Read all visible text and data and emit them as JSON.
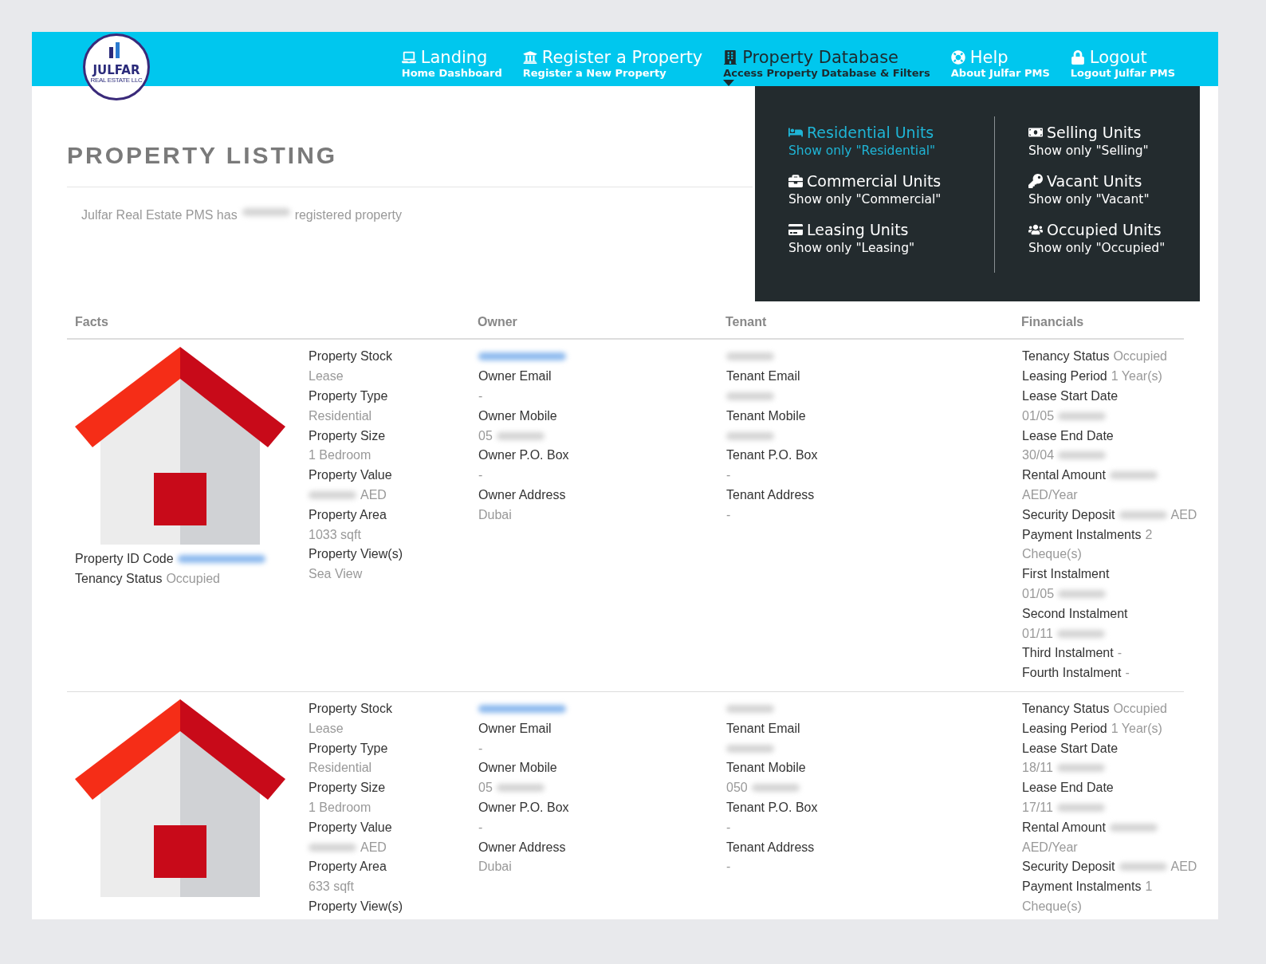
{
  "logo": {
    "name": "JULFAR",
    "tagline": "REAL ESTATE LLC"
  },
  "nav": [
    {
      "title": "Landing",
      "subtitle": "Home Dashboard",
      "selected": false
    },
    {
      "title": "Register a Property",
      "subtitle": "Register a New Property",
      "selected": false
    },
    {
      "title": "Property Database",
      "subtitle": "Access Property Database & Filters",
      "selected": true
    },
    {
      "title": "Help",
      "subtitle": "About Julfar PMS",
      "selected": false
    },
    {
      "title": "Logout",
      "subtitle": "Logout Julfar PMS",
      "selected": false
    }
  ],
  "dropdown": {
    "columns": [
      [
        {
          "title": "Residential Units",
          "subtitle": "Show only \"Residential\"",
          "selected": true
        },
        {
          "title": "Commercial Units",
          "subtitle": "Show only \"Commercial\"",
          "selected": false
        },
        {
          "title": "Leasing Units",
          "subtitle": "Show only \"Leasing\"",
          "selected": false
        }
      ],
      [
        {
          "title": "Selling Units",
          "subtitle": "Show only \"Selling\"",
          "selected": false
        },
        {
          "title": "Vacant Units",
          "subtitle": "Show only \"Vacant\"",
          "selected": false
        },
        {
          "title": "Occupied Units",
          "subtitle": "Show only \"Occupied\"",
          "selected": false
        }
      ]
    ]
  },
  "heading": "PROPERTY LISTING",
  "summary": [
    {
      "kind": "value",
      "text": "Julfar Real Estate PMS has"
    },
    {
      "kind": "blurred"
    },
    {
      "kind": "value",
      "text": "registered property"
    }
  ],
  "table": {
    "columns": [
      "Facts",
      "Owner",
      "Tenant",
      "Financials"
    ],
    "rows": [
      {
        "side": [
          [
            {
              "kind": "label",
              "text": "Property ID Code"
            },
            {
              "kind": "blurred_link"
            }
          ],
          [
            {
              "kind": "label",
              "text": "Tenancy Status"
            },
            {
              "kind": "value",
              "text": "Occupied"
            }
          ]
        ],
        "facts": [
          [
            {
              "kind": "label",
              "text": "Property Stock"
            }
          ],
          [
            {
              "kind": "value",
              "text": "Lease"
            }
          ],
          [
            {
              "kind": "label",
              "text": "Property Type"
            }
          ],
          [
            {
              "kind": "value",
              "text": "Residential"
            }
          ],
          [
            {
              "kind": "label",
              "text": "Property Size"
            }
          ],
          [
            {
              "kind": "value",
              "text": "1 Bedroom"
            }
          ],
          [
            {
              "kind": "label",
              "text": "Property Value"
            }
          ],
          [
            {
              "kind": "blurred"
            },
            {
              "kind": "value",
              "text": "AED"
            }
          ],
          [
            {
              "kind": "label",
              "text": "Property Area"
            }
          ],
          [
            {
              "kind": "value",
              "text": "1033 sqft"
            }
          ],
          [
            {
              "kind": "label",
              "text": "Property View(s)"
            }
          ],
          [
            {
              "kind": "value",
              "text": "Sea View"
            }
          ]
        ],
        "owner": [
          [
            {
              "kind": "blurred_link"
            }
          ],
          [
            {
              "kind": "label",
              "text": "Owner Email"
            }
          ],
          [
            {
              "kind": "value",
              "text": "-"
            }
          ],
          [
            {
              "kind": "label",
              "text": "Owner Mobile"
            }
          ],
          [
            {
              "kind": "value",
              "text": "05"
            },
            {
              "kind": "blurred"
            }
          ],
          [
            {
              "kind": "label",
              "text": "Owner P.O. Box"
            }
          ],
          [
            {
              "kind": "value",
              "text": "-"
            }
          ],
          [
            {
              "kind": "label",
              "text": "Owner Address"
            }
          ],
          [
            {
              "kind": "value",
              "text": "Dubai"
            }
          ]
        ],
        "tenant": [
          [
            {
              "kind": "blurred"
            }
          ],
          [
            {
              "kind": "label",
              "text": "Tenant Email"
            }
          ],
          [
            {
              "kind": "blurred"
            }
          ],
          [
            {
              "kind": "label",
              "text": "Tenant Mobile"
            }
          ],
          [
            {
              "kind": "blurred"
            }
          ],
          [
            {
              "kind": "label",
              "text": "Tenant P.O. Box"
            }
          ],
          [
            {
              "kind": "value",
              "text": "-"
            }
          ],
          [
            {
              "kind": "label",
              "text": "Tenant Address"
            }
          ],
          [
            {
              "kind": "value",
              "text": "-"
            }
          ]
        ],
        "financials": [
          [
            {
              "kind": "label",
              "text": "Tenancy Status"
            },
            {
              "kind": "value",
              "text": "Occupied"
            }
          ],
          [
            {
              "kind": "label",
              "text": "Leasing Period"
            },
            {
              "kind": "value",
              "text": "1 Year(s)"
            }
          ],
          [
            {
              "kind": "label",
              "text": "Lease Start Date"
            }
          ],
          [
            {
              "kind": "value",
              "text": "01/05"
            },
            {
              "kind": "blurred"
            }
          ],
          [
            {
              "kind": "label",
              "text": "Lease End Date"
            }
          ],
          [
            {
              "kind": "value",
              "text": "30/04"
            },
            {
              "kind": "blurred"
            }
          ],
          [
            {
              "kind": "label",
              "text": "Rental Amount"
            },
            {
              "kind": "blurred"
            }
          ],
          [
            {
              "kind": "value",
              "text": "AED/Year"
            }
          ],
          [
            {
              "kind": "label",
              "text": "Security Deposit"
            },
            {
              "kind": "blurred"
            },
            {
              "kind": "value",
              "text": "AED"
            }
          ],
          [
            {
              "kind": "label",
              "text": "Payment Instalments"
            },
            {
              "kind": "value",
              "text": "2"
            }
          ],
          [
            {
              "kind": "value",
              "text": "Cheque(s)"
            }
          ],
          [
            {
              "kind": "label",
              "text": "First Instalment"
            }
          ],
          [
            {
              "kind": "value",
              "text": "01/05"
            },
            {
              "kind": "blurred"
            }
          ],
          [
            {
              "kind": "label",
              "text": "Second Instalment"
            }
          ],
          [
            {
              "kind": "value",
              "text": "01/11"
            },
            {
              "kind": "blurred"
            }
          ],
          [
            {
              "kind": "label",
              "text": "Third Instalment"
            },
            {
              "kind": "value",
              "text": "-"
            }
          ],
          [
            {
              "kind": "label",
              "text": "Fourth Instalment"
            },
            {
              "kind": "value",
              "text": "-"
            }
          ]
        ]
      },
      {
        "facts": [
          [
            {
              "kind": "label",
              "text": "Property Stock"
            }
          ],
          [
            {
              "kind": "value",
              "text": "Lease"
            }
          ],
          [
            {
              "kind": "label",
              "text": "Property Type"
            }
          ],
          [
            {
              "kind": "value",
              "text": "Residential"
            }
          ],
          [
            {
              "kind": "label",
              "text": "Property Size"
            }
          ],
          [
            {
              "kind": "value",
              "text": "1 Bedroom"
            }
          ],
          [
            {
              "kind": "label",
              "text": "Property Value"
            }
          ],
          [
            {
              "kind": "blurred"
            },
            {
              "kind": "value",
              "text": "AED"
            }
          ],
          [
            {
              "kind": "label",
              "text": "Property Area"
            }
          ],
          [
            {
              "kind": "value",
              "text": "633 sqft"
            }
          ],
          [
            {
              "kind": "label",
              "text": "Property View(s)"
            }
          ]
        ],
        "owner": [
          [
            {
              "kind": "blurred_link"
            }
          ],
          [
            {
              "kind": "label",
              "text": "Owner Email"
            }
          ],
          [
            {
              "kind": "value",
              "text": "-"
            }
          ],
          [
            {
              "kind": "label",
              "text": "Owner Mobile"
            }
          ],
          [
            {
              "kind": "value",
              "text": "05"
            },
            {
              "kind": "blurred"
            }
          ],
          [
            {
              "kind": "label",
              "text": "Owner P.O. Box"
            }
          ],
          [
            {
              "kind": "value",
              "text": "-"
            }
          ],
          [
            {
              "kind": "label",
              "text": "Owner Address"
            }
          ],
          [
            {
              "kind": "value",
              "text": "Dubai"
            }
          ]
        ],
        "tenant": [
          [
            {
              "kind": "blurred"
            }
          ],
          [
            {
              "kind": "label",
              "text": "Tenant Email"
            }
          ],
          [
            {
              "kind": "blurred"
            }
          ],
          [
            {
              "kind": "label",
              "text": "Tenant Mobile"
            }
          ],
          [
            {
              "kind": "value",
              "text": "050"
            },
            {
              "kind": "blurred"
            }
          ],
          [
            {
              "kind": "label",
              "text": "Tenant P.O. Box"
            }
          ],
          [
            {
              "kind": "value",
              "text": "-"
            }
          ],
          [
            {
              "kind": "label",
              "text": "Tenant Address"
            }
          ],
          [
            {
              "kind": "value",
              "text": "-"
            }
          ]
        ],
        "financials": [
          [
            {
              "kind": "label",
              "text": "Tenancy Status"
            },
            {
              "kind": "value",
              "text": "Occupied"
            }
          ],
          [
            {
              "kind": "label",
              "text": "Leasing Period"
            },
            {
              "kind": "value",
              "text": "1 Year(s)"
            }
          ],
          [
            {
              "kind": "label",
              "text": "Lease Start Date"
            }
          ],
          [
            {
              "kind": "value",
              "text": "18/11"
            },
            {
              "kind": "blurred"
            }
          ],
          [
            {
              "kind": "label",
              "text": "Lease End Date"
            }
          ],
          [
            {
              "kind": "value",
              "text": "17/11"
            },
            {
              "kind": "blurred"
            }
          ],
          [
            {
              "kind": "label",
              "text": "Rental Amount"
            },
            {
              "kind": "blurred"
            }
          ],
          [
            {
              "kind": "value",
              "text": "AED/Year"
            }
          ],
          [
            {
              "kind": "label",
              "text": "Security Deposit"
            },
            {
              "kind": "blurred"
            },
            {
              "kind": "value",
              "text": "AED"
            }
          ],
          [
            {
              "kind": "label",
              "text": "Payment Instalments"
            },
            {
              "kind": "value",
              "text": "1"
            }
          ],
          [
            {
              "kind": "value",
              "text": "Cheque(s)"
            }
          ]
        ]
      }
    ]
  }
}
